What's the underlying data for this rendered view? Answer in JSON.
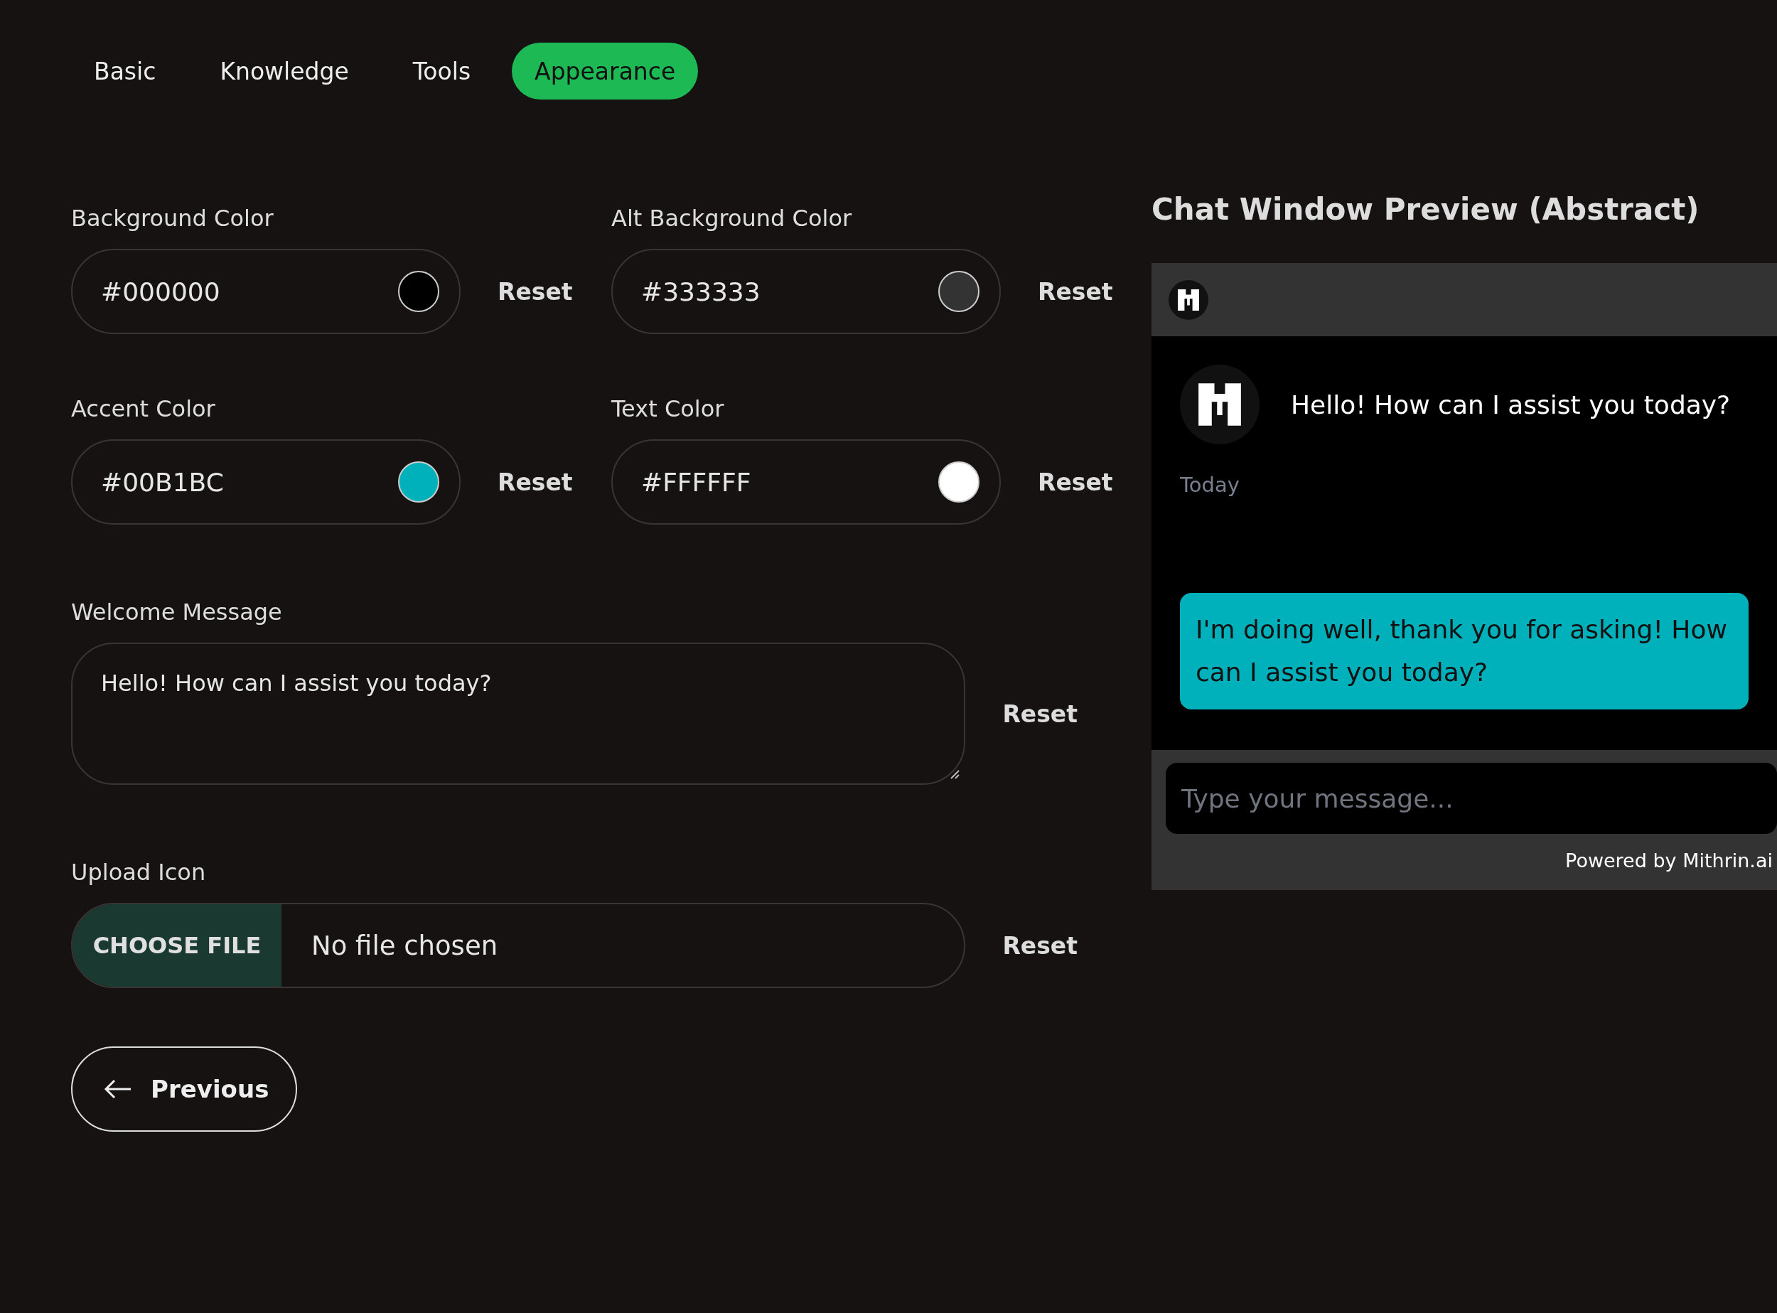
{
  "tabs": [
    {
      "label": "Basic",
      "selected": false
    },
    {
      "label": "Knowledge",
      "selected": false
    },
    {
      "label": "Tools",
      "selected": false
    },
    {
      "label": "Appearance",
      "selected": true
    }
  ],
  "color_fields": [
    {
      "label": "Background Color",
      "value": "#000000",
      "reset": "Reset"
    },
    {
      "label": "Alt Background Color",
      "value": "#333333",
      "reset": "Reset"
    },
    {
      "label": "Accent Color",
      "value": "#00B1BC",
      "reset": "Reset"
    },
    {
      "label": "Text Color",
      "value": "#FFFFFF",
      "reset": "Reset"
    }
  ],
  "welcome_message": {
    "label": "Welcome Message",
    "value": "Hello! How can I assist you today?",
    "reset": "Reset"
  },
  "upload_icon": {
    "label": "Upload Icon",
    "button": "CHOOSE FILE",
    "status": "No file chosen",
    "reset": "Reset"
  },
  "previous_button": "Previous",
  "preview": {
    "title": "Chat Window Preview (Abstract)",
    "bot_message": "Hello! How can I assist you today?",
    "date": "Today",
    "user_message": "I'm doing well, thank you for asking! How can I assist you today?",
    "input": {
      "placeholder": "Type your message..."
    },
    "footer": "Powered by Mithrin.ai"
  }
}
